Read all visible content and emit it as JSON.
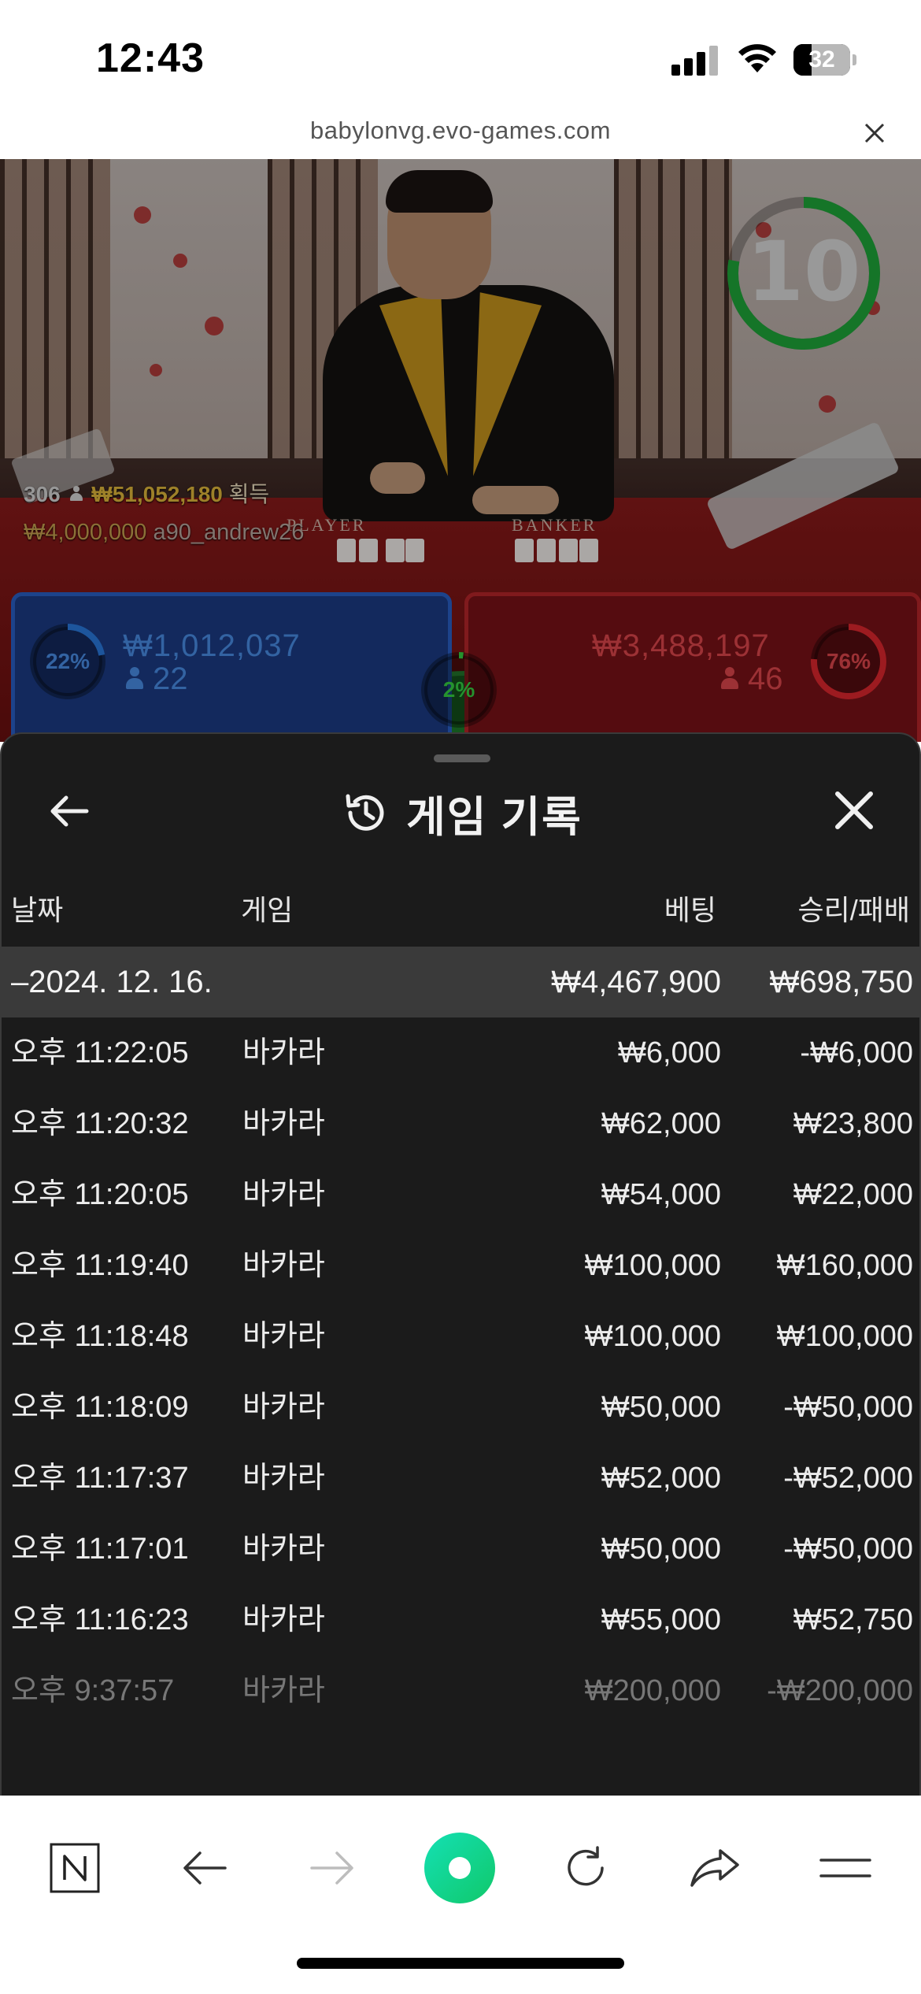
{
  "status_bar": {
    "time": "12:43",
    "battery": "32",
    "battery_level": 0.32
  },
  "url_bar": {
    "url": "babylonvg.evo-games.com"
  },
  "game": {
    "timer": "10",
    "table_words": {
      "player": "PLAYER",
      "banker": "BANKER"
    },
    "winners_count": "306",
    "winners_amount": "₩51,052,180",
    "winners_suffix": "획득",
    "top_win_amount": "₩4,000,000",
    "top_win_user": "a90_andrew26",
    "player": {
      "percent": "22%",
      "percent_value": 0.22,
      "amount": "₩1,012,037",
      "count": "22",
      "color": "#2a61c8"
    },
    "tie": {
      "percent": "2%",
      "percent_value": 0.02,
      "color": "#36b243"
    },
    "banker": {
      "percent": "76%",
      "percent_value": 0.76,
      "amount": "₩3,488,197",
      "count": "46",
      "color": "#b8262a"
    }
  },
  "history": {
    "title": "게임 기록",
    "columns": {
      "date": "날짜",
      "game": "게임",
      "bet": "베팅",
      "result": "승리/패배"
    },
    "group": {
      "date": "–2024. 12. 16.",
      "bet": "₩4,467,900",
      "result": "₩698,750"
    },
    "rows": [
      {
        "time": "오후 11:22:05",
        "game": "바카라",
        "bet": "₩6,000",
        "result": "-₩6,000"
      },
      {
        "time": "오후 11:20:32",
        "game": "바카라",
        "bet": "₩62,000",
        "result": "₩23,800"
      },
      {
        "time": "오후 11:20:05",
        "game": "바카라",
        "bet": "₩54,000",
        "result": "₩22,000"
      },
      {
        "time": "오후 11:19:40",
        "game": "바카라",
        "bet": "₩100,000",
        "result": "₩160,000"
      },
      {
        "time": "오후 11:18:48",
        "game": "바카라",
        "bet": "₩100,000",
        "result": "₩100,000"
      },
      {
        "time": "오후 11:18:09",
        "game": "바카라",
        "bet": "₩50,000",
        "result": "-₩50,000"
      },
      {
        "time": "오후 11:17:37",
        "game": "바카라",
        "bet": "₩52,000",
        "result": "-₩52,000"
      },
      {
        "time": "오후 11:17:01",
        "game": "바카라",
        "bet": "₩50,000",
        "result": "-₩50,000"
      },
      {
        "time": "오후 11:16:23",
        "game": "바카라",
        "bet": "₩55,000",
        "result": "₩52,750"
      },
      {
        "time": "오후 9:37:57",
        "game": "바카라",
        "bet": "₩200,000",
        "result": "-₩200,000"
      }
    ]
  },
  "toolbar": {
    "icons": [
      "naver-n-icon",
      "back-arrow-icon",
      "forward-arrow-icon",
      "green-dot-icon",
      "refresh-icon",
      "share-icon",
      "menu-icon"
    ],
    "accent": "#19d9a0"
  }
}
